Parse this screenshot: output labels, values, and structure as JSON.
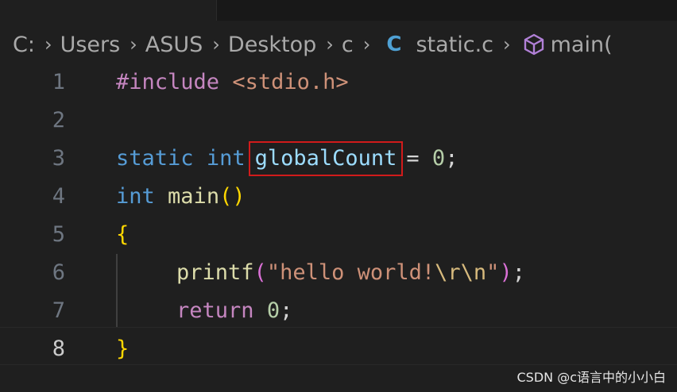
{
  "breadcrumb": {
    "items": [
      "C:",
      "Users",
      "ASUS",
      "Desktop",
      "c"
    ],
    "file_badge": "C",
    "file_name": "static.c",
    "symbol": "main("
  },
  "editor": {
    "lines": [
      {
        "number": "1",
        "tokens": [
          "#include",
          " ",
          "<stdio.h>"
        ]
      },
      {
        "number": "2",
        "tokens": []
      },
      {
        "number": "3",
        "tokens": [
          "static",
          " ",
          "int",
          "globalCount",
          "= ",
          "0",
          ";"
        ]
      },
      {
        "number": "4",
        "tokens": [
          "int",
          " ",
          "main",
          "(",
          ")"
        ]
      },
      {
        "number": "5",
        "tokens": [
          "{"
        ]
      },
      {
        "number": "6",
        "tokens": [
          "printf",
          "(",
          "\"hello world!",
          "\\r\\n",
          "\"",
          ")",
          ";"
        ]
      },
      {
        "number": "7",
        "tokens": [
          "return",
          " ",
          "0",
          ";"
        ]
      },
      {
        "number": "8",
        "tokens": [
          "}"
        ]
      }
    ],
    "active_line": "8"
  },
  "colors": {
    "highlight_border": "#d11b1b",
    "keyword": "#569cd6",
    "preprocessor": "#c586c0",
    "string": "#ce9178"
  },
  "watermark": "CSDN @c语言中的小小白"
}
